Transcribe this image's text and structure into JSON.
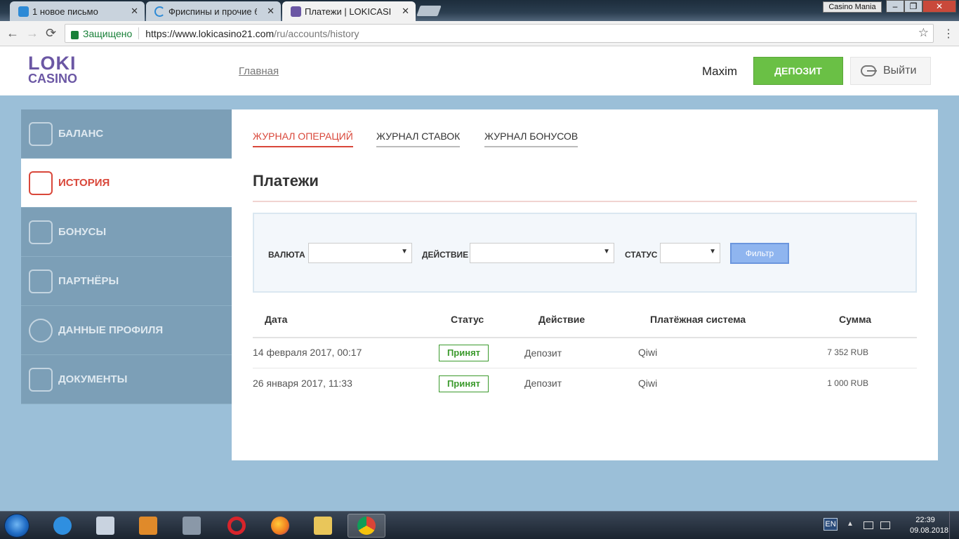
{
  "browser": {
    "tabs": [
      {
        "title": "1 новое письмо",
        "active": false
      },
      {
        "title": "Фриспины и прочие бо",
        "active": false
      },
      {
        "title": "Платежи | LOKICASINO.c",
        "active": true
      }
    ],
    "tab_close_glyph": "✕",
    "profile_name": "Casino Mania",
    "window_controls": {
      "minimize": "–",
      "maximize": "❐",
      "close": "✕"
    },
    "nav": {
      "back": "←",
      "forward": "→",
      "reload": "⟳"
    },
    "secure_label": "Защищено",
    "url_main": "https://www.lokicasino21.com",
    "url_path": "/ru/accounts/history",
    "star_glyph": "☆",
    "menu_glyph": "⋮"
  },
  "site": {
    "logo": {
      "line1": "LOKI",
      "line2": "CASINO"
    },
    "nav_home": "Главная",
    "username": "Maxim",
    "deposit_label": "ДЕПОЗИТ",
    "logout_label": "Выйти"
  },
  "sidebar": {
    "items": [
      {
        "label": "БАЛАНС",
        "icon": "wallet-icon",
        "active": false
      },
      {
        "label": "ИСТОРИЯ",
        "icon": "calendar-clock-icon",
        "active": true
      },
      {
        "label": "БОНУСЫ",
        "icon": "gift-icon",
        "active": false
      },
      {
        "label": "ПАРТНЁРЫ",
        "icon": "megaphone-icon",
        "active": false
      },
      {
        "label": "ДАННЫЕ ПРОФИЛЯ",
        "icon": "user-icon",
        "active": false
      },
      {
        "label": "ДОКУМЕНТЫ",
        "icon": "id-card-icon",
        "active": false
      }
    ]
  },
  "main": {
    "journal_tabs": [
      {
        "label": "ЖУРНАЛ ОПЕРАЦИЙ",
        "active": true
      },
      {
        "label": "ЖУРНАЛ СТАВОК",
        "active": false
      },
      {
        "label": "ЖУРНАЛ БОНУСОВ",
        "active": false
      }
    ],
    "title": "Платежи",
    "filters": {
      "currency_label": "ВАЛЮТА",
      "action_label": "ДЕЙСТВИЕ",
      "status_label": "СТАТУС",
      "currency_value": "",
      "action_value": "",
      "status_value": "",
      "caret": "▼",
      "button_label": "Фильтр"
    },
    "table": {
      "headers": [
        "Дата",
        "Статус",
        "Действие",
        "Платёжная система",
        "Сумма"
      ],
      "rows": [
        {
          "date": "14 февраля 2017, 00:17",
          "status": "Принят",
          "action": "Депозит",
          "system": "Qiwi",
          "amount": "7 352 RUB"
        },
        {
          "date": "26 января 2017, 11:33",
          "status": "Принят",
          "action": "Депозит",
          "system": "Qiwi",
          "amount": "1 000 RUB"
        }
      ]
    }
  },
  "taskbar": {
    "apps": [
      {
        "icon": "internet-explorer-icon",
        "color": "#2f8fe0"
      },
      {
        "icon": "media-player-classic-icon",
        "color": "#c9d3e0"
      },
      {
        "icon": "video-player-icon",
        "color": "#e08a2a"
      },
      {
        "icon": "counter-strike-icon",
        "color": "#8a98a8"
      },
      {
        "icon": "opera-icon",
        "color": "#d8242b"
      },
      {
        "icon": "firefox-icon",
        "color": "#f07a1e"
      },
      {
        "icon": "file-explorer-icon",
        "color": "#e9c65a"
      },
      {
        "icon": "chrome-icon",
        "color": "#3ba55c"
      }
    ],
    "language": "EN",
    "tray_up": "▲",
    "time": "22:39",
    "date": "09.08.2018"
  },
  "colors": {
    "brand_purple": "#6b57a4",
    "accent_red": "#d9473a",
    "deposit_green": "#6ac045",
    "status_green": "#3b9a2c",
    "page_bg": "#9bbfd8"
  }
}
